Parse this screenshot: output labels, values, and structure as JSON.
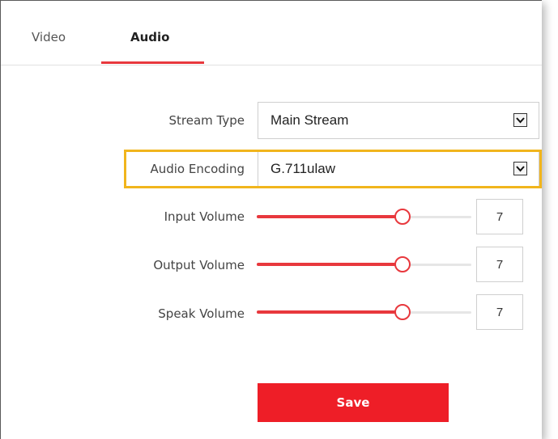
{
  "tabs": [
    {
      "label": "Video",
      "active": false
    },
    {
      "label": "Audio",
      "active": true
    }
  ],
  "form": {
    "stream_type": {
      "label": "Stream Type",
      "value": "Main Stream"
    },
    "audio_encoding": {
      "label": "Audio Encoding",
      "value": "G.711ulaw",
      "highlighted": true
    },
    "input_volume": {
      "label": "Input Volume",
      "value": "7",
      "level": 0.68
    },
    "output_volume": {
      "label": "Output Volume",
      "value": "7",
      "level": 0.68
    },
    "speak_volume": {
      "label": "Speak Volume",
      "value": "7",
      "level": 0.68
    }
  },
  "actions": {
    "save_label": "Save"
  },
  "colors": {
    "accent": "#e8383d",
    "save_button": "#ee1e27",
    "highlight_border": "#f1b51c",
    "track": "#e6e6e6"
  }
}
